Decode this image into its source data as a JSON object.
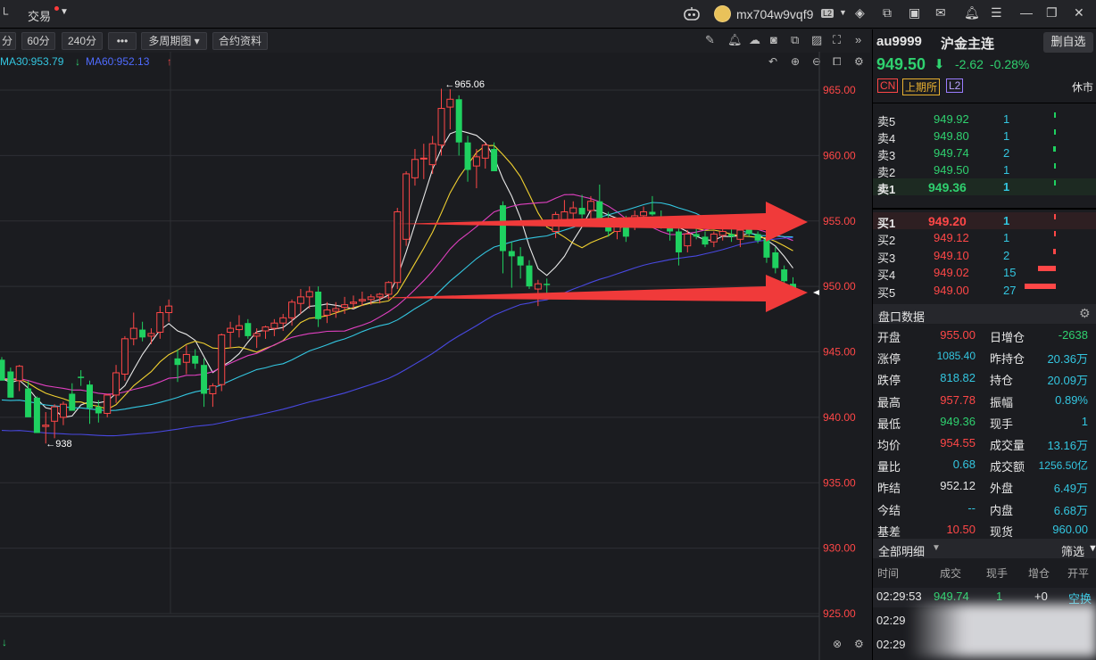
{
  "titlebar": {
    "left_text": "交易",
    "user": "mx704w9vqf9",
    "user_badge": "L2"
  },
  "toolbar": {
    "buttons": [
      "分",
      "60分",
      "240分",
      "•••",
      "多周期图 ▾",
      "合约资料"
    ]
  },
  "ma_legend": {
    "ma30": "MA30:953.79",
    "ma60": "MA60:952.13",
    "ma60_arrow": "↓",
    "end_arrow": "↑",
    "colors": {
      "ma30": "#33c6e0",
      "ma60": "#4848e0"
    }
  },
  "chart_data": {
    "type": "candlestick",
    "ylim": [
      925,
      965
    ],
    "y_ticks": [
      "965.00",
      "960.00",
      "955.00",
      "950.00",
      "945.00",
      "940.00",
      "935.00",
      "930.00",
      "925.00"
    ],
    "annotations": [
      {
        "label": "←965.06",
        "value": 965.06
      },
      {
        "label": "←938",
        "value": 938
      }
    ],
    "candles": [
      [
        944.4,
        944.6,
        943.0,
        942.8
      ],
      [
        943.5,
        943.8,
        942.2,
        941.5
      ],
      [
        942.8,
        944.0,
        942.0,
        943.9
      ],
      [
        942.2,
        942.8,
        940.3,
        940.0
      ],
      [
        941.5,
        941.6,
        939.6,
        938.8
      ],
      [
        939.3,
        940.4,
        938.0,
        939.4
      ],
      [
        939.7,
        941.0,
        938.4,
        940.8
      ],
      [
        940.0,
        941.2,
        939.4,
        941.0
      ],
      [
        941.8,
        942.6,
        940.5,
        940.5
      ],
      [
        943.1,
        943.6,
        942.4,
        943.0
      ],
      [
        942.5,
        942.8,
        939.5,
        940.7
      ],
      [
        940.8,
        941.3,
        939.6,
        940.3
      ],
      [
        940.3,
        941.8,
        940.0,
        941.7
      ],
      [
        941.7,
        944.0,
        941.1,
        943.4
      ],
      [
        943.3,
        946.2,
        942.8,
        946.0
      ],
      [
        946.0,
        948.0,
        945.5,
        946.8
      ],
      [
        946.7,
        947.3,
        945.8,
        946.1
      ],
      [
        946.2,
        946.8,
        945.6,
        946.4
      ],
      [
        946.5,
        948.5,
        946.0,
        948.0
      ],
      [
        948.0,
        949.0,
        947.3,
        948.5
      ],
      [
        944.5,
        945.2,
        942.7,
        944.0
      ],
      [
        944.2,
        945.5,
        943.3,
        944.8
      ],
      [
        944.7,
        945.2,
        943.7,
        944.1
      ],
      [
        944.0,
        944.5,
        940.8,
        941.8
      ],
      [
        941.8,
        942.6,
        940.8,
        942.4
      ],
      [
        942.5,
        946.4,
        942.0,
        946.3
      ],
      [
        946.5,
        947.3,
        945.3,
        946.8
      ],
      [
        946.7,
        947.8,
        946.1,
        947.0
      ],
      [
        947.2,
        947.5,
        946.0,
        946.2
      ],
      [
        946.2,
        946.8,
        945.3,
        946.4
      ],
      [
        946.6,
        947.0,
        946.0,
        946.9
      ],
      [
        946.8,
        947.5,
        946.2,
        947.2
      ],
      [
        947.2,
        947.9,
        946.6,
        947.6
      ],
      [
        947.6,
        949.0,
        947.0,
        948.8
      ],
      [
        948.7,
        949.8,
        947.9,
        949.2
      ],
      [
        949.2,
        950.0,
        948.3,
        949.6
      ],
      [
        949.6,
        950.0,
        946.9,
        947.5
      ],
      [
        947.8,
        948.8,
        947.2,
        948.2
      ],
      [
        948.1,
        948.8,
        947.6,
        948.3
      ],
      [
        948.4,
        949.2,
        947.9,
        948.6
      ],
      [
        948.7,
        949.3,
        948.3,
        948.8
      ],
      [
        948.9,
        949.6,
        948.5,
        949.0
      ],
      [
        949.0,
        949.4,
        948.6,
        949.2
      ],
      [
        949.2,
        949.5,
        948.7,
        949.4
      ],
      [
        949.4,
        950.4,
        949.0,
        950.3
      ],
      [
        950.3,
        956.0,
        949.8,
        955.7
      ],
      [
        953.6,
        958.8,
        953.1,
        958.6
      ],
      [
        958.3,
        960.5,
        957.7,
        959.7
      ],
      [
        959.8,
        960.9,
        958.2,
        959.8
      ],
      [
        959.3,
        961.5,
        958.6,
        960.9
      ],
      [
        960.8,
        965.1,
        960.0,
        963.6
      ],
      [
        963.7,
        965.06,
        962.0,
        964.3
      ],
      [
        964.3,
        964.6,
        960.0,
        961.0
      ],
      [
        961.0,
        961.5,
        958.0,
        958.9
      ],
      [
        959.2,
        960.5,
        957.5,
        959.9
      ],
      [
        959.8,
        961.0,
        959.0,
        960.8
      ],
      [
        960.5,
        961.0,
        959.0,
        958.8
      ],
      [
        956.2,
        956.5,
        951.0,
        952.7
      ],
      [
        952.7,
        953.4,
        949.9,
        952.3
      ],
      [
        952.3,
        953.0,
        950.6,
        951.6
      ],
      [
        951.6,
        952.0,
        949.8,
        950.0
      ],
      [
        949.8,
        950.5,
        948.5,
        950.2
      ],
      [
        950.2,
        950.6,
        949.2,
        950.1
      ],
      [
        954.2,
        955.7,
        953.7,
        955.5
      ],
      [
        955.1,
        956.6,
        954.6,
        955.7
      ],
      [
        955.6,
        956.5,
        954.6,
        956.0
      ],
      [
        956.0,
        957.0,
        955.2,
        955.5
      ],
      [
        955.8,
        956.9,
        955.0,
        956.5
      ],
      [
        956.5,
        957.78,
        955.4,
        955.1
      ],
      [
        955.2,
        955.7,
        953.8,
        954.2
      ],
      [
        954.2,
        955.0,
        953.6,
        954.7
      ],
      [
        954.7,
        955.4,
        953.4,
        953.8
      ],
      [
        955.1,
        955.8,
        954.3,
        955.4
      ],
      [
        955.4,
        956.1,
        954.9,
        955.7
      ],
      [
        955.7,
        956.9,
        955.4,
        955.5
      ],
      [
        955.2,
        955.8,
        954.4,
        954.6
      ],
      [
        954.6,
        955.2,
        953.5,
        954.2
      ],
      [
        954.2,
        954.5,
        951.6,
        952.6
      ],
      [
        953.1,
        954.3,
        952.6,
        954.0
      ],
      [
        954.0,
        954.4,
        953.6,
        953.8
      ],
      [
        953.8,
        954.2,
        953.0,
        953.2
      ],
      [
        953.4,
        954.2,
        953.0,
        954.0
      ],
      [
        953.9,
        954.5,
        953.5,
        954.2
      ],
      [
        954.0,
        954.6,
        953.4,
        953.8
      ],
      [
        953.6,
        954.5,
        953.0,
        954.3
      ],
      [
        954.4,
        955.0,
        953.8,
        954.0
      ],
      [
        954.0,
        954.2,
        953.3,
        953.5
      ],
      [
        953.6,
        954.0,
        951.8,
        952.2
      ],
      [
        952.6,
        953.0,
        951.0,
        951.4
      ],
      [
        951.3,
        951.6,
        949.8,
        950.4
      ],
      [
        950.2,
        950.7,
        949.36,
        949.5
      ]
    ],
    "series_colors": {
      "ma5": "#e8e8e8",
      "ma10": "#f0d030",
      "ma20": "#e040c0",
      "ma30": "#33c6e0",
      "ma60": "#4848e0"
    }
  },
  "quote": {
    "code": "au9999",
    "name": "沪金主连",
    "fav_button": "删自选",
    "price": "949.50",
    "change": "-2.62",
    "change_pct": "-0.28%",
    "arrow": "⬇",
    "tags": [
      "CN",
      "上期所",
      "L2"
    ],
    "status": "休市"
  },
  "order_book": {
    "asks": [
      {
        "label": "卖5",
        "price": "949.92",
        "vol": "1",
        "vol_num": 1
      },
      {
        "label": "卖4",
        "price": "949.80",
        "vol": "1",
        "vol_num": 1
      },
      {
        "label": "卖3",
        "price": "949.74",
        "vol": "2",
        "vol_num": 2
      },
      {
        "label": "卖2",
        "price": "949.50",
        "vol": "1",
        "vol_num": 1
      },
      {
        "label": "卖1",
        "price": "949.36",
        "vol": "1",
        "vol_num": 1
      }
    ],
    "bids": [
      {
        "label": "买1",
        "price": "949.20",
        "vol": "1",
        "vol_num": 1
      },
      {
        "label": "买2",
        "price": "949.12",
        "vol": "1",
        "vol_num": 1
      },
      {
        "label": "买3",
        "price": "949.10",
        "vol": "2",
        "vol_num": 2
      },
      {
        "label": "买4",
        "price": "949.02",
        "vol": "15",
        "vol_num": 15
      },
      {
        "label": "买5",
        "price": "949.00",
        "vol": "27",
        "vol_num": 27
      }
    ]
  },
  "pankou": {
    "title": "盘口数据",
    "rows": [
      {
        "l1": "开盘",
        "v1": "955.00",
        "c1": "red",
        "l2": "日增仓",
        "v2": "-2638",
        "c2": "green"
      },
      {
        "l1": "涨停",
        "v1": "1085.40",
        "c1": "cyan",
        "l2": "昨持仓",
        "v2": "20.36万",
        "c2": "cyan"
      },
      {
        "l1": "跌停",
        "v1": "818.82",
        "c1": "cyan",
        "l2": "持仓",
        "v2": "20.09万",
        "c2": "cyan"
      },
      {
        "l1": "最高",
        "v1": "957.78",
        "c1": "red",
        "l2": "振幅",
        "v2": "0.89%",
        "c2": "cyan"
      },
      {
        "l1": "最低",
        "v1": "949.36",
        "c1": "green",
        "l2": "现手",
        "v2": "1",
        "c2": "cyan"
      },
      {
        "l1": "均价",
        "v1": "954.55",
        "c1": "red",
        "l2": "成交量",
        "v2": "13.16万",
        "c2": "cyan"
      },
      {
        "l1": "量比",
        "v1": "0.68",
        "c1": "cyan",
        "l2": "成交额",
        "v2": "1256.50亿",
        "c2": "cyan"
      },
      {
        "l1": "昨结",
        "v1": "952.12",
        "c1": "white",
        "l2": "外盘",
        "v2": "6.49万",
        "c2": "cyan"
      },
      {
        "l1": "今结",
        "v1": "--",
        "c1": "cyan",
        "l2": "内盘",
        "v2": "6.68万",
        "c2": "cyan"
      },
      {
        "l1": "基差",
        "v1": "10.50",
        "c1": "red",
        "l2": "现货",
        "v2": "960.00",
        "c2": "cyan"
      }
    ]
  },
  "trades": {
    "title": "全部明细",
    "filter": "筛选",
    "headers": [
      "时间",
      "成交",
      "现手",
      "增仓",
      "开平"
    ],
    "rows": [
      {
        "time": "02:29:53",
        "price": "949.74",
        "vol": "1",
        "oi": "+0",
        "type": "空换"
      },
      {
        "time": "02:29",
        "price": "",
        "vol": "",
        "oi": "",
        "type": ""
      },
      {
        "time": "02:29",
        "price": "",
        "vol": "",
        "oi": "",
        "type": ""
      }
    ]
  }
}
